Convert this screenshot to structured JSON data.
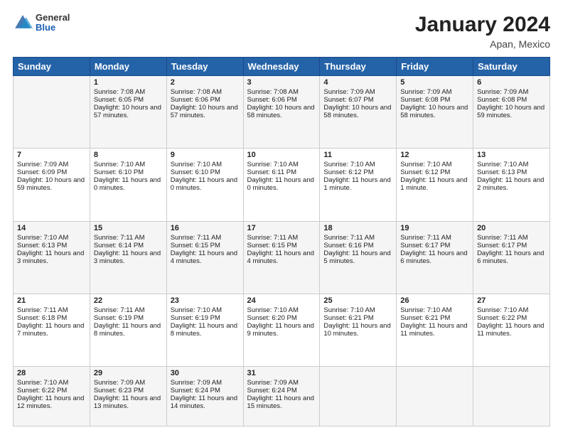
{
  "header": {
    "logo": {
      "line1": "General",
      "line2": "Blue"
    },
    "title": "January 2024",
    "subtitle": "Apan, Mexico"
  },
  "days_of_week": [
    "Sunday",
    "Monday",
    "Tuesday",
    "Wednesday",
    "Thursday",
    "Friday",
    "Saturday"
  ],
  "weeks": [
    [
      {
        "day": "",
        "sunrise": "",
        "sunset": "",
        "daylight": ""
      },
      {
        "day": "1",
        "sunrise": "Sunrise: 7:08 AM",
        "sunset": "Sunset: 6:05 PM",
        "daylight": "Daylight: 10 hours and 57 minutes."
      },
      {
        "day": "2",
        "sunrise": "Sunrise: 7:08 AM",
        "sunset": "Sunset: 6:06 PM",
        "daylight": "Daylight: 10 hours and 57 minutes."
      },
      {
        "day": "3",
        "sunrise": "Sunrise: 7:08 AM",
        "sunset": "Sunset: 6:06 PM",
        "daylight": "Daylight: 10 hours and 58 minutes."
      },
      {
        "day": "4",
        "sunrise": "Sunrise: 7:09 AM",
        "sunset": "Sunset: 6:07 PM",
        "daylight": "Daylight: 10 hours and 58 minutes."
      },
      {
        "day": "5",
        "sunrise": "Sunrise: 7:09 AM",
        "sunset": "Sunset: 6:08 PM",
        "daylight": "Daylight: 10 hours and 58 minutes."
      },
      {
        "day": "6",
        "sunrise": "Sunrise: 7:09 AM",
        "sunset": "Sunset: 6:08 PM",
        "daylight": "Daylight: 10 hours and 59 minutes."
      }
    ],
    [
      {
        "day": "7",
        "sunrise": "Sunrise: 7:09 AM",
        "sunset": "Sunset: 6:09 PM",
        "daylight": "Daylight: 10 hours and 59 minutes."
      },
      {
        "day": "8",
        "sunrise": "Sunrise: 7:10 AM",
        "sunset": "Sunset: 6:10 PM",
        "daylight": "Daylight: 11 hours and 0 minutes."
      },
      {
        "day": "9",
        "sunrise": "Sunrise: 7:10 AM",
        "sunset": "Sunset: 6:10 PM",
        "daylight": "Daylight: 11 hours and 0 minutes."
      },
      {
        "day": "10",
        "sunrise": "Sunrise: 7:10 AM",
        "sunset": "Sunset: 6:11 PM",
        "daylight": "Daylight: 11 hours and 0 minutes."
      },
      {
        "day": "11",
        "sunrise": "Sunrise: 7:10 AM",
        "sunset": "Sunset: 6:12 PM",
        "daylight": "Daylight: 11 hours and 1 minute."
      },
      {
        "day": "12",
        "sunrise": "Sunrise: 7:10 AM",
        "sunset": "Sunset: 6:12 PM",
        "daylight": "Daylight: 11 hours and 1 minute."
      },
      {
        "day": "13",
        "sunrise": "Sunrise: 7:10 AM",
        "sunset": "Sunset: 6:13 PM",
        "daylight": "Daylight: 11 hours and 2 minutes."
      }
    ],
    [
      {
        "day": "14",
        "sunrise": "Sunrise: 7:10 AM",
        "sunset": "Sunset: 6:13 PM",
        "daylight": "Daylight: 11 hours and 3 minutes."
      },
      {
        "day": "15",
        "sunrise": "Sunrise: 7:11 AM",
        "sunset": "Sunset: 6:14 PM",
        "daylight": "Daylight: 11 hours and 3 minutes."
      },
      {
        "day": "16",
        "sunrise": "Sunrise: 7:11 AM",
        "sunset": "Sunset: 6:15 PM",
        "daylight": "Daylight: 11 hours and 4 minutes."
      },
      {
        "day": "17",
        "sunrise": "Sunrise: 7:11 AM",
        "sunset": "Sunset: 6:15 PM",
        "daylight": "Daylight: 11 hours and 4 minutes."
      },
      {
        "day": "18",
        "sunrise": "Sunrise: 7:11 AM",
        "sunset": "Sunset: 6:16 PM",
        "daylight": "Daylight: 11 hours and 5 minutes."
      },
      {
        "day": "19",
        "sunrise": "Sunrise: 7:11 AM",
        "sunset": "Sunset: 6:17 PM",
        "daylight": "Daylight: 11 hours and 6 minutes."
      },
      {
        "day": "20",
        "sunrise": "Sunrise: 7:11 AM",
        "sunset": "Sunset: 6:17 PM",
        "daylight": "Daylight: 11 hours and 6 minutes."
      }
    ],
    [
      {
        "day": "21",
        "sunrise": "Sunrise: 7:11 AM",
        "sunset": "Sunset: 6:18 PM",
        "daylight": "Daylight: 11 hours and 7 minutes."
      },
      {
        "day": "22",
        "sunrise": "Sunrise: 7:11 AM",
        "sunset": "Sunset: 6:19 PM",
        "daylight": "Daylight: 11 hours and 8 minutes."
      },
      {
        "day": "23",
        "sunrise": "Sunrise: 7:10 AM",
        "sunset": "Sunset: 6:19 PM",
        "daylight": "Daylight: 11 hours and 8 minutes."
      },
      {
        "day": "24",
        "sunrise": "Sunrise: 7:10 AM",
        "sunset": "Sunset: 6:20 PM",
        "daylight": "Daylight: 11 hours and 9 minutes."
      },
      {
        "day": "25",
        "sunrise": "Sunrise: 7:10 AM",
        "sunset": "Sunset: 6:21 PM",
        "daylight": "Daylight: 11 hours and 10 minutes."
      },
      {
        "day": "26",
        "sunrise": "Sunrise: 7:10 AM",
        "sunset": "Sunset: 6:21 PM",
        "daylight": "Daylight: 11 hours and 11 minutes."
      },
      {
        "day": "27",
        "sunrise": "Sunrise: 7:10 AM",
        "sunset": "Sunset: 6:22 PM",
        "daylight": "Daylight: 11 hours and 11 minutes."
      }
    ],
    [
      {
        "day": "28",
        "sunrise": "Sunrise: 7:10 AM",
        "sunset": "Sunset: 6:22 PM",
        "daylight": "Daylight: 11 hours and 12 minutes."
      },
      {
        "day": "29",
        "sunrise": "Sunrise: 7:09 AM",
        "sunset": "Sunset: 6:23 PM",
        "daylight": "Daylight: 11 hours and 13 minutes."
      },
      {
        "day": "30",
        "sunrise": "Sunrise: 7:09 AM",
        "sunset": "Sunset: 6:24 PM",
        "daylight": "Daylight: 11 hours and 14 minutes."
      },
      {
        "day": "31",
        "sunrise": "Sunrise: 7:09 AM",
        "sunset": "Sunset: 6:24 PM",
        "daylight": "Daylight: 11 hours and 15 minutes."
      },
      {
        "day": "",
        "sunrise": "",
        "sunset": "",
        "daylight": ""
      },
      {
        "day": "",
        "sunrise": "",
        "sunset": "",
        "daylight": ""
      },
      {
        "day": "",
        "sunrise": "",
        "sunset": "",
        "daylight": ""
      }
    ]
  ]
}
